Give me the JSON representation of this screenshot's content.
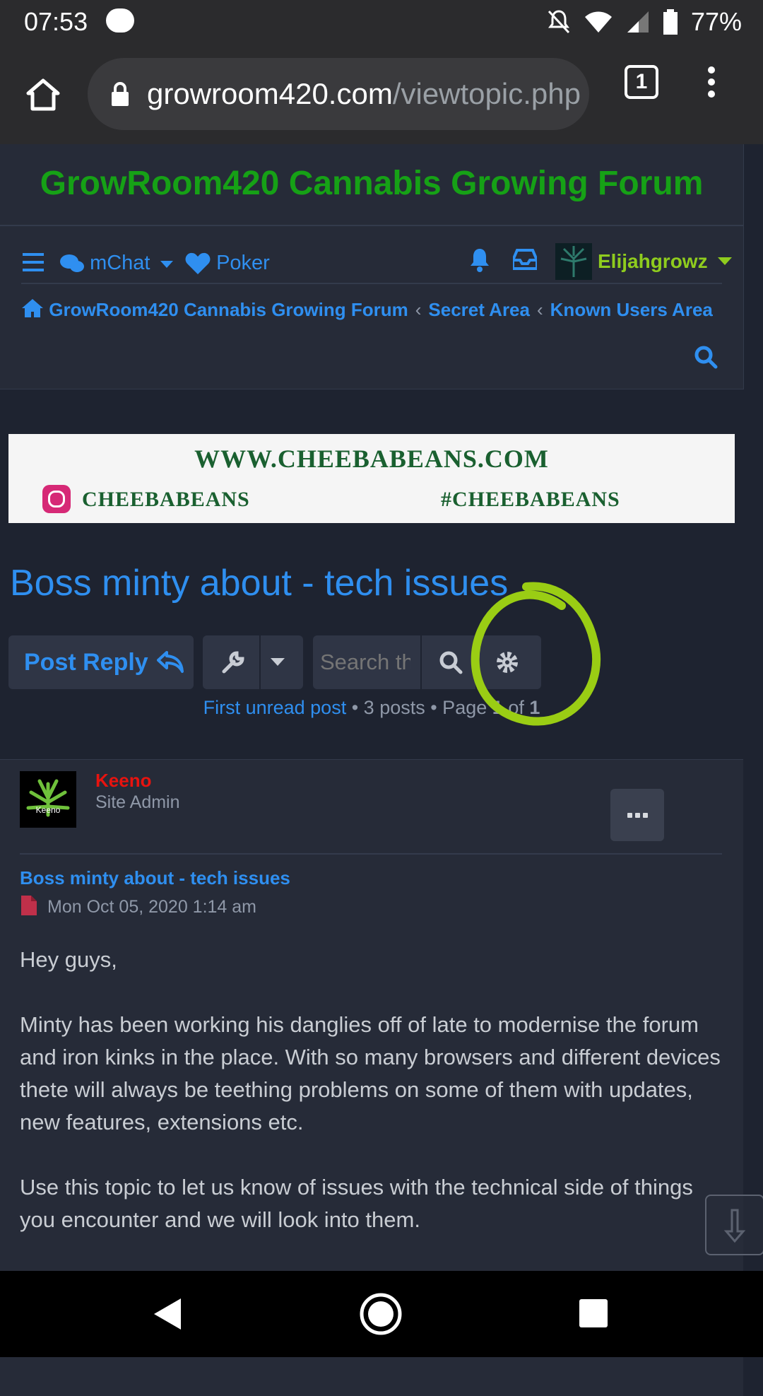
{
  "status": {
    "time": "07:53",
    "battery": "77%"
  },
  "browser": {
    "url_host": "growroom420.com",
    "url_path": "/viewtopic.php",
    "tab_count": "1"
  },
  "site": {
    "title": "GrowRoom420 Cannabis Growing Forum"
  },
  "nav": {
    "mchat": "mChat",
    "poker": "Poker",
    "username": "Elijahgrowz"
  },
  "breadcrumbs": [
    "GrowRoom420 Cannabis Growing Forum",
    "Secret Area",
    "Known Users Area"
  ],
  "banner": {
    "line1": "WWW.CHEEBABEANS.COM",
    "instagram": "CHEEBABEANS",
    "hashtag": "#CHEEBABEANS"
  },
  "topic": {
    "title": "Boss minty about - tech issues",
    "post_reply": "Post Reply",
    "search_placeholder": "Search this topic…",
    "first_unread": "First unread post",
    "posts_count": "• 3 posts • Page",
    "page_current": "1",
    "of": "of",
    "page_total": "1"
  },
  "post": {
    "author": "Keeno",
    "avatar_text": "Keeno",
    "rank": "Site Admin",
    "subject": "Boss minty about - tech issues",
    "date": "Mon Oct 05, 2020 1:14 am",
    "paragraphs": [
      "Hey guys,",
      "Minty has been working his danglies off of late to modernise the forum and iron kinks in the place. With so many browsers and different devices thete will always be teething problems on some of them with updates, new features, extensions etc.",
      "Use this topic to let us know of issues with the technical side of things you encounter and we will look into them."
    ]
  },
  "colors": {
    "accent": "#2f8ff0",
    "site_title": "#16a116",
    "username": "#8fcc1e",
    "author": "#e8130f",
    "highlight_circle": "#9acd14"
  }
}
